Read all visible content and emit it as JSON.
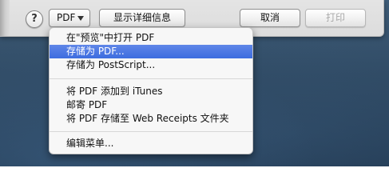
{
  "sheet": {
    "help_label": "?",
    "pdf_button_label": "PDF",
    "details_button_label": "显示详细信息",
    "cancel_button_label": "取消",
    "print_button_label": "打印"
  },
  "menu": {
    "items": [
      {
        "label": "在\"预览\"中打开 PDF"
      },
      {
        "label": "存储为 PDF...",
        "highlighted": true
      },
      {
        "label": "存储为 PostScript..."
      },
      {
        "label": "将 PDF 添加到 iTunes"
      },
      {
        "label": "邮寄 PDF"
      },
      {
        "label": "将 PDF 存储至 Web Receipts 文件夹"
      },
      {
        "label": "编辑菜单..."
      }
    ]
  }
}
